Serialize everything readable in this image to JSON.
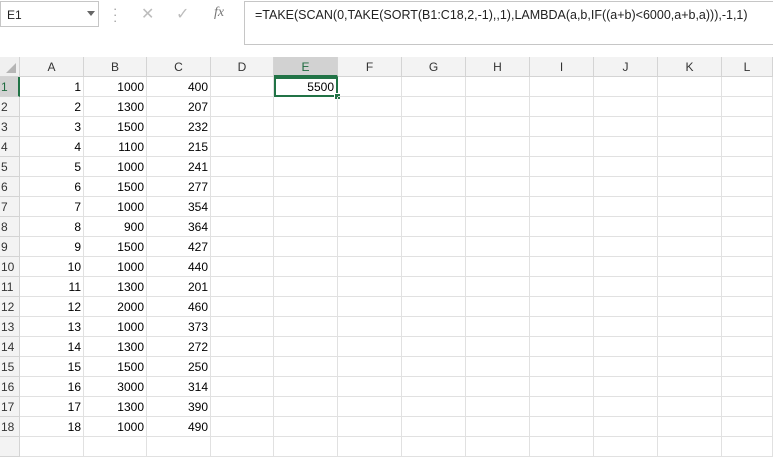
{
  "name_box": {
    "value": "E1"
  },
  "formula_bar": {
    "cancel_icon": "close-icon",
    "enter_icon": "checkmark-icon",
    "fx_label": "fx",
    "formula": "=TAKE(SCAN(0,TAKE(SORT(B1:C18,2,-1),,1),LAMBDA(a,b,IF((a+b)<6000,a+b,a))),-1,1)"
  },
  "sheet": {
    "columns": [
      "A",
      "B",
      "C",
      "D",
      "E",
      "F",
      "G",
      "H",
      "I",
      "J",
      "K",
      "L"
    ],
    "selected_column": "E",
    "selected_row": 1,
    "active_cell": "E1",
    "rows": [
      {
        "num": "1",
        "A": "1",
        "B": "1000",
        "C": "400",
        "E": "5500"
      },
      {
        "num": "2",
        "A": "2",
        "B": "1300",
        "C": "207"
      },
      {
        "num": "3",
        "A": "3",
        "B": "1500",
        "C": "232"
      },
      {
        "num": "4",
        "A": "4",
        "B": "1100",
        "C": "215"
      },
      {
        "num": "5",
        "A": "5",
        "B": "1000",
        "C": "241"
      },
      {
        "num": "6",
        "A": "6",
        "B": "1500",
        "C": "277"
      },
      {
        "num": "7",
        "A": "7",
        "B": "1000",
        "C": "354"
      },
      {
        "num": "8",
        "A": "8",
        "B": "900",
        "C": "364"
      },
      {
        "num": "9",
        "A": "9",
        "B": "1500",
        "C": "427"
      },
      {
        "num": "10",
        "A": "10",
        "B": "1000",
        "C": "440"
      },
      {
        "num": "11",
        "A": "11",
        "B": "1300",
        "C": "201"
      },
      {
        "num": "12",
        "A": "12",
        "B": "2000",
        "C": "460"
      },
      {
        "num": "13",
        "A": "13",
        "B": "1000",
        "C": "373"
      },
      {
        "num": "14",
        "A": "14",
        "B": "1300",
        "C": "272"
      },
      {
        "num": "15",
        "A": "15",
        "B": "1500",
        "C": "250"
      },
      {
        "num": "16",
        "A": "16",
        "B": "3000",
        "C": "314"
      },
      {
        "num": "17",
        "A": "17",
        "B": "1300",
        "C": "390"
      },
      {
        "num": "18",
        "A": "18",
        "B": "1000",
        "C": "490"
      }
    ]
  },
  "colors": {
    "accent": "#217346",
    "gridline": "#e1e1e1",
    "header_bg": "#f3f3f3"
  }
}
